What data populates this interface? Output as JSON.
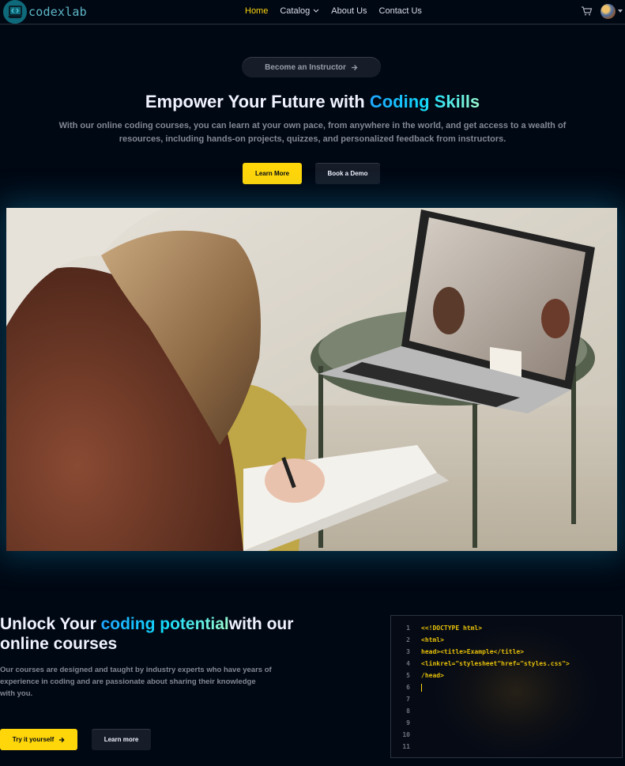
{
  "nav": {
    "logo_text": "codexlab",
    "links": [
      {
        "label": "Home",
        "active": true
      },
      {
        "label": "Catalog",
        "dropdown": true
      },
      {
        "label": "About Us"
      },
      {
        "label": "Contact Us"
      }
    ],
    "icons": [
      "cart-icon",
      "avatar",
      "caret-down-icon"
    ]
  },
  "hero": {
    "instructor_button": "Become an Instructor",
    "title_plain": "Empower Your Future with ",
    "title_highlight": "Coding Skills",
    "subtitle": "With our online coding courses, you can learn at your own pace, from anywhere in the world, and get access to a wealth of resources, including hands-on projects, quizzes, and personalized feedback from instructors.",
    "learn_more": "Learn More",
    "book_demo": "Book a Demo"
  },
  "section2": {
    "title_before": "Unlock Your ",
    "title_highlight": "coding potential",
    "title_after": "with our online courses",
    "subtitle": "Our courses are designed and taught by industry experts who have years of experience in coding and are passionate about sharing their knowledge with you.",
    "try_button": "Try it yourself",
    "learn_more": "Learn more",
    "code_lines": [
      {
        "n": "1",
        "t": "<<!DOCTYPE html>"
      },
      {
        "n": "2",
        "t": "<html>"
      },
      {
        "n": "3",
        "t": "head><title>Example</title>"
      },
      {
        "n": "4",
        "t": "<linkrel=\"stylesheet\"href=\"styles.css\">"
      },
      {
        "n": "5",
        "t": "/head>"
      },
      {
        "n": "6",
        "t": ""
      },
      {
        "n": "7",
        "t": ""
      },
      {
        "n": "8",
        "t": ""
      },
      {
        "n": "9",
        "t": ""
      },
      {
        "n": "10",
        "t": ""
      },
      {
        "n": "11",
        "t": ""
      }
    ]
  },
  "colors": {
    "background": "#000814",
    "accent_yellow": "#FFD60A",
    "gradient": [
      "#1FA2FF",
      "#12D8FA",
      "#A6FFCB"
    ],
    "code_text": "#E7C009"
  }
}
